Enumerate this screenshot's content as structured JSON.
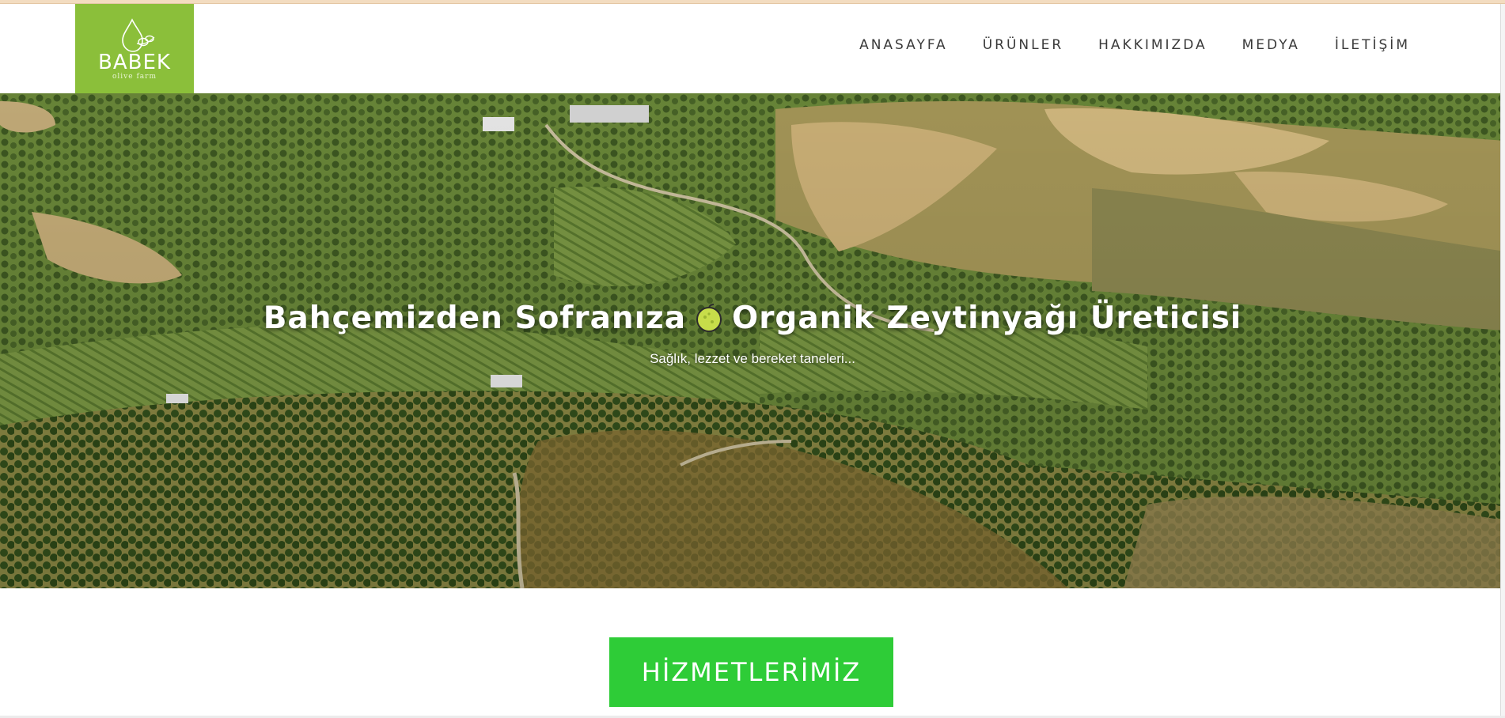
{
  "brand": {
    "name": "BABEK",
    "tagline": "olive farm",
    "color": "#8bbf3a"
  },
  "nav": {
    "items": [
      {
        "label": "ANASAYFA"
      },
      {
        "label": "ÜRÜNLER"
      },
      {
        "label": "HAKKIMIZDA"
      },
      {
        "label": "MEDYA"
      },
      {
        "label": "İLETİŞİM"
      }
    ]
  },
  "hero": {
    "title_left": "Bahçemizden Sofranıza",
    "title_right": "Organik Zeytinyağı Üreticisi",
    "title_icon": "melon-icon",
    "subtitle": "Sağlık, lezzet ve bereket taneleri..."
  },
  "services": {
    "button_label": "HİZMETLERİMİZ",
    "button_color": "#2ecc37"
  }
}
